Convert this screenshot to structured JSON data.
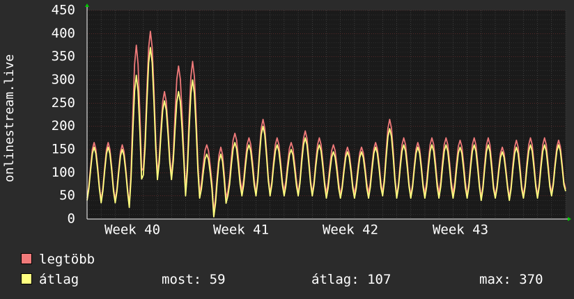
{
  "chart_data": {
    "type": "line",
    "ylabel": "onlinestream.live",
    "ylim": [
      0,
      450
    ],
    "yticks": [
      0,
      50,
      100,
      150,
      200,
      250,
      300,
      350,
      400,
      450
    ],
    "x_labels": [
      "Week 40",
      "Week 41",
      "Week 42",
      "Week 43"
    ],
    "grid": true,
    "colors": {
      "background": "#2b2b2b",
      "plot": "#1a1a1a",
      "grid": "#555555",
      "legbtb": "#f07a7a",
      "atlag": "#ffff80"
    },
    "days": 34,
    "series": [
      {
        "name": "legtöbb",
        "color": "#f07a7a",
        "daily_peaks": [
          165,
          165,
          160,
          375,
          405,
          275,
          330,
          340,
          160,
          155,
          185,
          175,
          215,
          175,
          165,
          190,
          175,
          160,
          155,
          155,
          165,
          215,
          175,
          165,
          175,
          175,
          170,
          175,
          175,
          155,
          170,
          175,
          175,
          170
        ],
        "daily_troughs": [
          45,
          40,
          40,
          30,
          110,
          95,
          90,
          60,
          55,
          15,
          60,
          60,
          55,
          55,
          60,
          55,
          55,
          55,
          50,
          55,
          55,
          55,
          50,
          50,
          55,
          55,
          55,
          50,
          45,
          50,
          45,
          50,
          50,
          55
        ]
      },
      {
        "name": "átlag",
        "color": "#ffff80",
        "daily_peaks": [
          155,
          155,
          150,
          310,
          370,
          255,
          275,
          300,
          140,
          140,
          165,
          160,
          200,
          160,
          150,
          175,
          160,
          145,
          145,
          145,
          155,
          195,
          160,
          155,
          160,
          160,
          155,
          160,
          160,
          145,
          155,
          160,
          160,
          160
        ],
        "daily_troughs": [
          40,
          35,
          35,
          25,
          95,
          85,
          85,
          50,
          45,
          5,
          50,
          50,
          50,
          50,
          50,
          50,
          50,
          45,
          45,
          45,
          45,
          50,
          45,
          45,
          45,
          45,
          45,
          45,
          40,
          45,
          40,
          45,
          45,
          50
        ]
      }
    ]
  },
  "legend": {
    "series1": "legtöbb",
    "series2": "átlag",
    "most": "most: 59",
    "avg": "átlag: 107",
    "max": "max: 370"
  }
}
